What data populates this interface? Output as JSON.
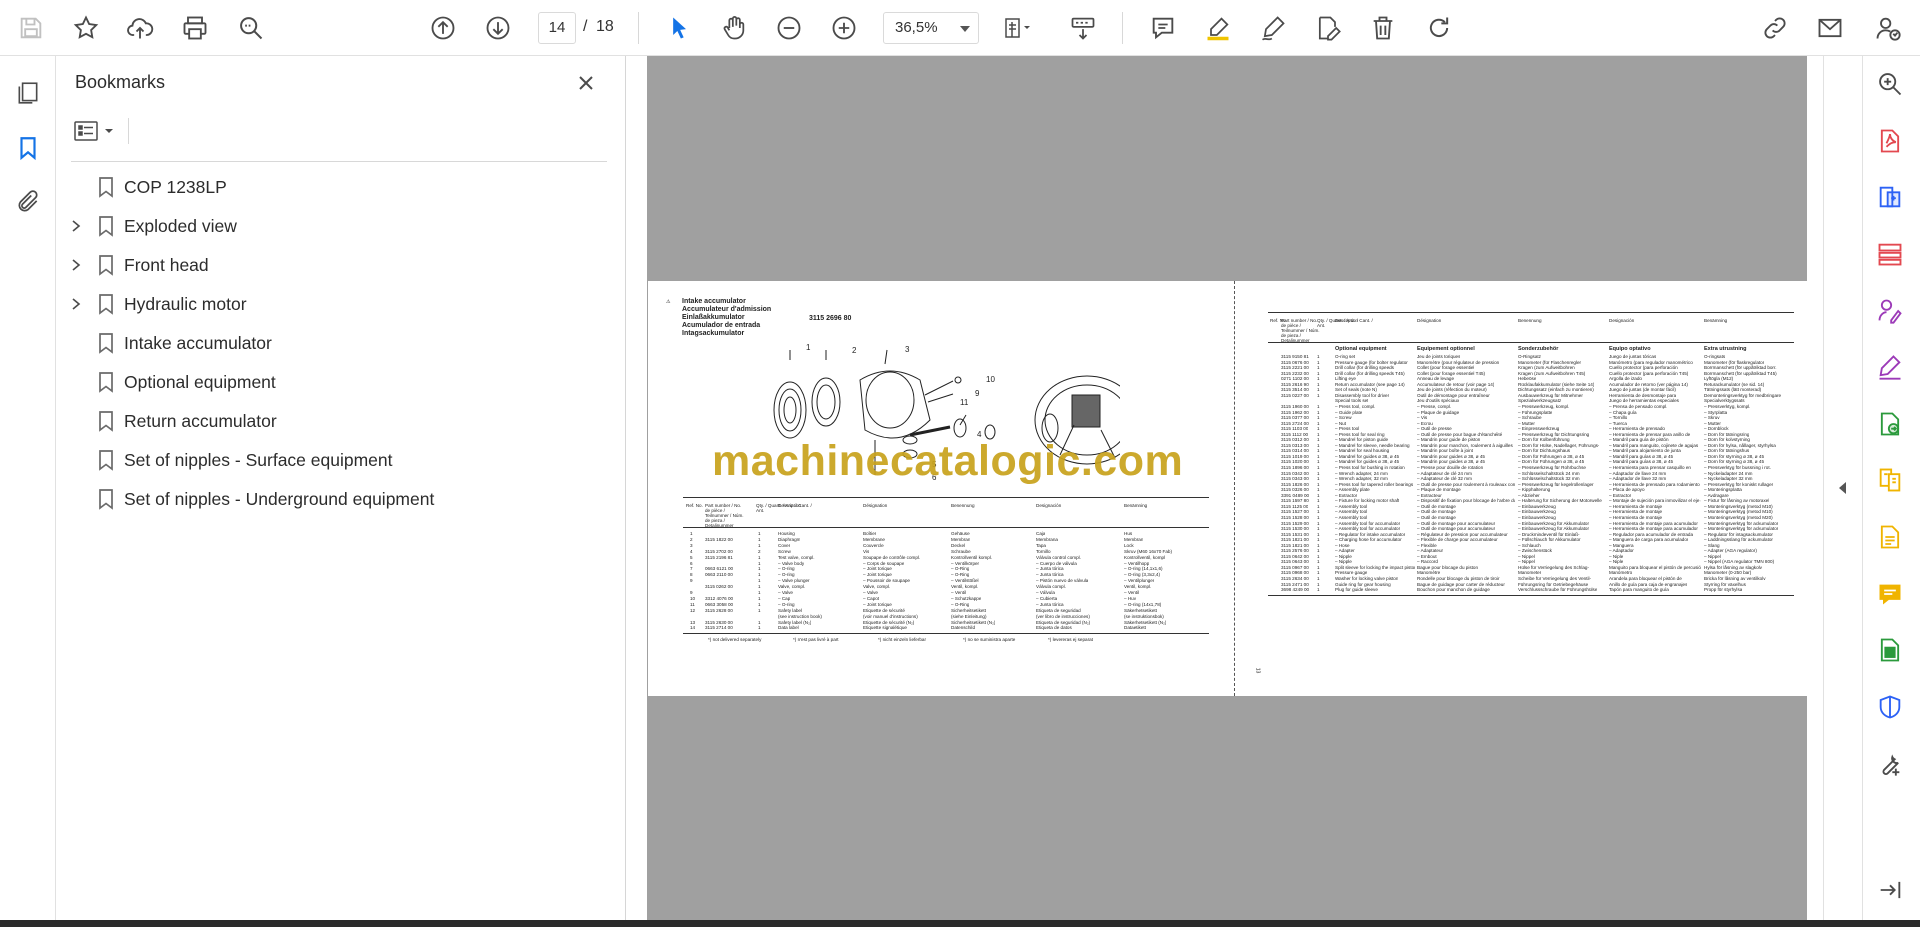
{
  "toolbar": {
    "current_page": "14",
    "page_separator": "/",
    "total_pages": "18",
    "zoom": "36,5%"
  },
  "bookmarks": {
    "title": "Bookmarks",
    "items": [
      {
        "label": "COP 1238LP",
        "expandable": false
      },
      {
        "label": "Exploded view",
        "expandable": true
      },
      {
        "label": "Front head",
        "expandable": true
      },
      {
        "label": "Hydraulic motor",
        "expandable": true
      },
      {
        "label": "Intake accumulator",
        "expandable": false
      },
      {
        "label": "Optional equipment",
        "expandable": false
      },
      {
        "label": "Return accumulator",
        "expandable": false
      },
      {
        "label": "Set of nipples - Surface equipment",
        "expandable": false
      },
      {
        "label": "Set of nipples - Underground equipment",
        "expandable": false
      }
    ]
  },
  "document": {
    "left_page": {
      "page_number": "12",
      "titles": [
        "Intake accumulator",
        "Accumulateur d'admission",
        "Einlaßakkumulator",
        "Acumulador de entrada",
        "Intagsackumulator"
      ],
      "part_number": "3115 2696 80",
      "headers": [
        "Ref. No.",
        "Part number / No. de pièce / Teilnummer / Núm. de pieza / Detaljnummer",
        "Qty. / Quant. / Anz. / Cant. / Ant.",
        "Description",
        "Désignation",
        "Benennung",
        "Designación",
        "Benämning"
      ],
      "rows": [
        [
          "1",
          "",
          "1",
          "Housing",
          "Boîtier",
          "Gehäuse",
          "Caja",
          "Hus"
        ],
        [
          "2",
          "3115 1822 00",
          "1",
          "Diaphragm",
          "Membrane",
          "Membran",
          "Membrana",
          "Membran"
        ],
        [
          "3",
          "",
          "1",
          "Cover",
          "Couvercle",
          "Deckel",
          "Tapa",
          "Lock"
        ],
        [
          "4",
          "3115 2702 00",
          "2",
          "Screw",
          "Vis",
          "Schraube",
          "Tornillo",
          "Skruv (M60 16x70 Fab)"
        ],
        [
          "5",
          "3115 2196 81",
          "1",
          "Test valve, compl.",
          "Soupape de contrôle compl.",
          "Kontrollventil kompl.",
          "Válvula control compl.",
          "Kontrollventil, kompl"
        ],
        [
          "6",
          "",
          "1",
          "– Valve body",
          "– Corps de soupape",
          "– Ventilkörper",
          "– Cuerpo de válvula",
          "– Ventilhopp"
        ],
        [
          "7",
          "0663 6121 00",
          "1",
          "– O-ring",
          "– Joint torique",
          "– O-Ring",
          "– Junta tórica",
          "– O-ring (14,1x1,6)"
        ],
        [
          "8",
          "0663 2110 00",
          "1",
          "– O-ring",
          "– Joint torique",
          "– O-Ring",
          "– Junta tórica",
          "– O-ring (3,3x2,4)"
        ],
        [
          "9",
          "",
          "1",
          "– Valve plunger",
          "– Poussoir de soupape",
          "– Ventilstößel",
          "– Pistón nuevo de válvula",
          "– Ventilplunger"
        ],
        [
          "",
          "3115 0262 00",
          "1",
          "Valve, compl.",
          "Valve, compl.",
          "Ventil, kompl.",
          "Válvula compl.",
          "Ventil, kompl."
        ],
        [
          "9",
          "",
          "1",
          "– Valve",
          "– Valve",
          "– Ventil",
          "– Válvula",
          "– Ventil"
        ],
        [
          "10",
          "3312 4076 00",
          "1",
          "– Cap",
          "– Capot",
          "– Schutzkappe",
          "– Cubierta",
          "– Huv"
        ],
        [
          "11",
          "0663 3058 00",
          "1",
          "– O-ring",
          "– Joint torique",
          "– O-Ring",
          "– Junta tórica",
          "– O-ring (14x1,78)"
        ],
        [
          "12",
          "3115 2628 00",
          "1",
          "Safety label",
          "Etiquette de sécurité",
          "Sicherheitsetikett",
          "Etiqueta de seguridad",
          "Säkerhetsetikett"
        ],
        [
          "",
          "",
          "",
          "(see instruction book)",
          "(voir manuel d'instructions)",
          "(siehe Einleitung)",
          "(ver libro de instrucciones)",
          "(se instruktionsbok)"
        ],
        [
          "13",
          "3115 2630 00",
          "1",
          "Safety label (N₂)",
          "Etiquette de sécurité (N₂)",
          "Sicherheitsetikett (N₂)",
          "Etiqueta de seguridad (N₂)",
          "Säkerhetsetikett (N₂)"
        ],
        [
          "14",
          "3115 2714 00",
          "1",
          "Data label",
          "Etiquette signalétique",
          "Datenschild",
          "Etiqueta de datos",
          "Dataetikett"
        ]
      ],
      "footnotes": [
        "*) not delivered separately",
        "*) n'est pas livré à part",
        "*) nicht einzeln lieferbar",
        "*) no se suministra aparte",
        "*) levereras ej separat"
      ],
      "callouts": [
        "1",
        "2",
        "3",
        "4",
        "5",
        "6",
        "9",
        "10",
        "11"
      ]
    },
    "right_page": {
      "page_number": "13",
      "headers": [
        "Ref. No.",
        "Part number / No. de pièce / Teilnummer / Núm. de pieza / Detaljnummer",
        "Qty. / Quant. / Anz. / Cant. / Ant.",
        "Description",
        "Désignation",
        "Benennung",
        "Designación",
        "Benämning"
      ],
      "section_titles": [
        "Optional equipment",
        "Equipement optionnel",
        "Sonderzubehör",
        "Equipo optativo",
        "Extra utrustning"
      ],
      "rows": [
        [
          "3115 9150 81",
          "1",
          "O-ring set",
          "Jeu de joints toriques",
          "O-Ringsatz",
          "Juego de juntas tóricas",
          "O-ringsats"
        ],
        [
          "3115 0676 00",
          "1",
          "Pressure gauge (for bolter regulator",
          "Manomètre (pour régulateur de pression",
          "Manometer (für Flaschenregler",
          "Manómetro (para regulador manométrico",
          "Manometer (för flaskregulator"
        ],
        [
          "3115 2221 00",
          "1",
          "Drill collar (for drilling speeds",
          "Collet (pour forage essentiel",
          "Kragen (zum Aufweitbohren",
          "Cuello protector (para perforación",
          "Borrmanschett (för uppåtriktad borr."
        ],
        [
          "3115 2232 00",
          "1",
          "Drill collar (for drilling speeds T45)",
          "Collet (pour forage essentiel T45)",
          "Kragen (zum Aufweitbohren T45)",
          "Cuello protector (para perforación T45)",
          "Borrmanschett (för uppåtriktad T45)"
        ],
        [
          "0271 1102 00",
          "1",
          "Lifting eye",
          "Anneau de levage",
          "Hebeöse",
          "Argolla de izado",
          "Lyftögla (M12)"
        ],
        [
          "3115 2616 90",
          "1",
          "Return accumulator (see page 14)",
          "Accumulateur de retour (voir page 14)",
          "Rücklaufakkumulator (siehe Seite 14)",
          "Acumulador de retorno (ver página 14)",
          "Returackumulator (se sid. 14)"
        ],
        [
          "3115 3514 00",
          "1",
          "Set of seals (note N)",
          "Jeu de joints (réfection du moteur)",
          "Dichtungssatz (einfach zu montieren)",
          "Juego de juntas (de montar fácil)",
          "Tätningssats (lätt monterad)"
        ],
        [
          "3115 0227 00",
          "1",
          "Disassembly tool for driver",
          "Outil de démontage pour entraîneur",
          "Ausbauwerkzeug für Mitnehmer",
          "Herramienta de desmontaje para",
          "Demonteringsverktyg för medbringare"
        ],
        [
          "",
          "",
          "Special tools set",
          "Jeu d'outils spéciaux",
          "Spezialwerkzeugsatz",
          "Juego de herramientas especiales",
          "Specialverktygssats"
        ],
        [
          "3115 1960 00",
          "1",
          "– Press tool, compl.",
          "– Presse, compl.",
          "– Presswerkzeug, kompl.",
          "– Prensa de pensado compl.",
          "– Pressverktyg, kompl."
        ],
        [
          "3115 1962 00",
          "1",
          "– Guide plate",
          "– Plaque de guidage",
          "– Führungsplatte",
          "– Chapa guía",
          "– Styrplatta"
        ],
        [
          "3115 0377 00",
          "1",
          "– Screw",
          "– Vis",
          "– Schraube",
          "– Tornillo",
          "– Skruv"
        ],
        [
          "3115 2724 00",
          "1",
          "– Nut",
          "– Ecrou",
          "– Mutter",
          "– Tuerca",
          "– Mutter"
        ],
        [
          "3115 1103 00",
          "1",
          "– Press tool",
          "– Outil de presse",
          "– Einpresswerkzeug",
          "– Herramienta de prensado",
          "– Dornblock"
        ],
        [
          "3115 1112 00",
          "1",
          "– Press tool for seal ring",
          "– Outil de presse pour bague d'étanchéité",
          "– Presswerkzeug für Dichtungsring",
          "– Herramienta de prensar para anillo de",
          "– Dorn för tätningsring"
        ],
        [
          "3115 0312 00",
          "1",
          "– Mandrel for piston guide",
          "– Mandrin pour guide de piston",
          "– Dorn für Kolbenführung",
          "– Mandril para guía de pistón",
          "– Dorn för kolvstyrning"
        ],
        [
          "3115 0313 00",
          "1",
          "– Mandrel for sleeve, needle bearing",
          "– Mandrin pour manchon, roulement à aiguilles",
          "– Dorn für Hülse, Nadellager, Führungs-",
          "– Mandril para manguito, cojinete de agujas",
          "– Dorn för hylsa, nållager, styrhylsa"
        ],
        [
          "3115 0314 00",
          "1",
          "– Mandrel for seal housing",
          "– Mandrin pour boîte à joint",
          "– Dorn für Dichtungshaus",
          "– Mandril para alojamiento de junta",
          "– Dorn för tätningshus"
        ],
        [
          "3115 1019 00",
          "1",
          "– Mandrel for guides ø 38, ø 45",
          "– Mandrin pour guides ø 38, ø 45",
          "– Dorn für Führungen ø 38, ø 45",
          "– Mandril para guías ø 38, ø 45",
          "– Dorn för styrning ø 38, ø 45"
        ],
        [
          "3115 1020 00",
          "1",
          "– Mandrel for guides ø 38, ø 45",
          "– Mandrin pour guides ø 38, ø 45",
          "– Dorn für Führungen ø 38, ø 45",
          "– Mandril para guías ø 38, ø 45",
          "– Dorn för styrning ø 38, ø 45"
        ],
        [
          "3115 1896 00",
          "1",
          "– Press tool for bushing in rotation",
          "– Presse pour douille de rotation",
          "– Presswerkzeug für Rohrbuchse",
          "– Herramienta para prensar casquillo en",
          "– Pressverktyg för bussning i rot."
        ],
        [
          "3115 0342 00",
          "1",
          "– Wrench adapter, 24 mm",
          "– Adaptateur de clé 24 mm",
          "– Schlüsselschaltstück 24 mm",
          "– Adaptador de llave 24 mm",
          "– Nyckeladapter 24 mm"
        ],
        [
          "3115 0343 00",
          "1",
          "– Wrench adapter, 32 mm",
          "– Adaptateur de clé 32 mm",
          "– Schlüsselschaltstück 32 mm",
          "– Adaptador de llave 32 mm",
          "– Nyckeladapter 32 mm"
        ],
        [
          "3115 1826 00",
          "1",
          "– Press tool for tapered roller bearings",
          "– Outil de presse pour roulement à rouleaux coniques",
          "– Presswerkzeug für kegelrollenlager",
          "– Herramienta de prensado para rodamiento",
          "– Pressverktyg för koniskt rullager"
        ],
        [
          "3115 0326 00",
          "1",
          "– Assembly plate",
          "– Plaque de montage",
          "– Kipphalterung",
          "– Placa de apoyo",
          "– Monteringsplatta"
        ],
        [
          "3391 0489 00",
          "1",
          "– Extractor",
          "– Extracteur",
          "– Abzieher",
          "– Extractor",
          "– Avdragare"
        ],
        [
          "3115 1597 80",
          "1",
          "– Fixture for locking motor shaft",
          "– Dispositif de fixation pour blocage de l'arbre du moteur",
          "– Halterung für Sicherung der Motorwelle",
          "– Montaje de sujeción para inmovilizar el eje del motor",
          "– Fixtur för låsning av motoraxel"
        ],
        [
          "3115 1125 00",
          "1",
          "– Assembly tool",
          "– Outil de montage",
          "– Einbauwerkzeug",
          "– Herramienta de montaje",
          "– Monteringsverktyg (metod M10)"
        ],
        [
          "3115 1527 00",
          "1",
          "– Assembly tool",
          "– Outil de montage",
          "– Einbauwerkzeug",
          "– Herramienta de montaje",
          "– Monteringsverktyg (metod M10)"
        ],
        [
          "3115 1528 00",
          "1",
          "– Assembly tool",
          "– Outil de montage",
          "– Einbauwerkzeug",
          "– Herramienta de montaje",
          "– Monteringsverktyg (metod M20)"
        ],
        [
          "3115 1529 00",
          "1",
          "– Assembly tool for accumulator",
          "– Outil de montage pour accumulateur",
          "– Einbauwerkzeug für Akkumulator",
          "– Herramienta de montaje para acumulador",
          "– Monteringsverktyg för ackumulator"
        ],
        [
          "3115 1530 00",
          "1",
          "– Assembly tool for accumulator",
          "– Outil de montage pour accumulateur",
          "– Einbauwerkzeug für Akkumulator",
          "– Herramienta de montaje para acumulador",
          "– Monteringsverktyg för ackumulator"
        ],
        [
          "3115 1531 00",
          "1",
          "– Regulator for intake accumulator",
          "– Régulateur de pression pour accumulateur",
          "– Druckmindeventil für Einlaß-",
          "– Regulador para acumulador de entrada",
          "– Regulator för intagsackumulator"
        ],
        [
          "3115 1821 00",
          "1",
          "– Charging hose for accumulator",
          "– Flexible de charge pour accumulateur",
          "– Füllschlauch für Akkumulator",
          "– Manguera de carga para acumulador",
          "– Laddningsslang för ackumulator"
        ],
        [
          "3115 1821 00",
          "1",
          "– Hose",
          "– Flexible",
          "– Schlauch",
          "– Manguera",
          "– Slang"
        ],
        [
          "3115 2576 00",
          "1",
          "– Adapter",
          "– Adaptateur",
          "– Zwischenstück",
          "– Adaptador",
          "– Adapter (AGA regulator)"
        ],
        [
          "3115 0642 00",
          "1",
          "– Nipple",
          "– Embout",
          "– Nippel",
          "– Niple",
          "– Nippel"
        ],
        [
          "3115 0643 00",
          "1",
          "– Nipple",
          "– Raccord",
          "– Nippel",
          "– Niple",
          "– Nippel (AGA regulator TMN 800)"
        ],
        [
          "3115 0967 00",
          "1",
          "Split sleeve for locking the impact piston",
          "Bague pour blocage du piston",
          "Hülse für Verriegelung des Schlag-",
          "Manguito para bloquear el pistón de percusión",
          "Hylsa för låsning av slagkolv"
        ],
        [
          "3115 0968 00",
          "1",
          "Pressure gauge",
          "Manomètre",
          "Manometer",
          "Manómetro",
          "Manometer (0-250 bar)"
        ],
        [
          "3115 2634 00",
          "1",
          "Washer for locking valve piston",
          "Rondelle pour blocage du piston de tiroir",
          "Scheibe für Verriegelung des Ventil-",
          "Arandela para bloquear el pistón de",
          "Bricka för låsning av ventilkolv"
        ],
        [
          "3115 2471 00",
          "1",
          "Guide ring for gear housing",
          "Bague de guidage pour carter de réducteur",
          "Führungsring für Getriebegehäuse",
          "Anillo de guía para caja de engranajes",
          "Styrring för växelhus"
        ],
        [
          "3698 4249 00",
          "1",
          "Plug for guide sleeve",
          "Bouchon pour manchon de guidage",
          "Verschlussschraube für Führungshülse",
          "Tapón para manguito de guía",
          "Propp för styrhylsa"
        ]
      ]
    },
    "watermark": "machinecatalogic.com"
  },
  "colors": {
    "accent_blue": "#1473e6",
    "canvas_gray": "#a0a0a0",
    "icon_gray": "#4b4b4b",
    "pdf_red": "#e34850",
    "share_blue": "#2d62f5",
    "stamp_purple": "#9c3ab8",
    "organize_green": "#2b9a3c",
    "comment_yellow": "#f0b400",
    "watermark_gold": "#c8a21c"
  }
}
